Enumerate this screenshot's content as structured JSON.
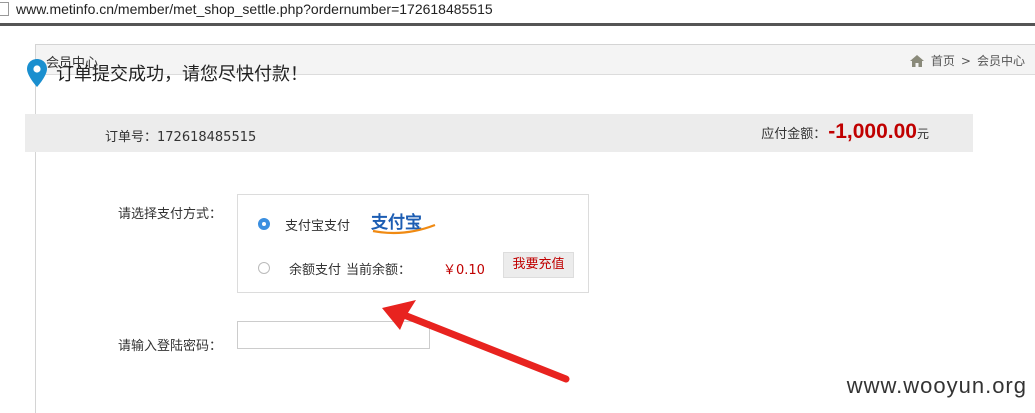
{
  "browser": {
    "url": "www.metinfo.cn/member/met_shop_settle.php?ordernumber=172618485515"
  },
  "panel": {
    "title": "会员中心",
    "breadcrumb": {
      "home": "首页",
      "separator": ">",
      "current": "会员中心"
    }
  },
  "message": {
    "success": "订单提交成功，请您尽快付款！"
  },
  "order": {
    "number_label": "订单号：",
    "number": "172618485515",
    "amount_label": "应付金额：",
    "amount": "-1,000.00",
    "amount_unit": "元"
  },
  "payment": {
    "label": "请选择支付方式：",
    "options": [
      {
        "label": "支付宝支付",
        "selected": true,
        "logo_text": "支付宝"
      },
      {
        "label": "余额支付",
        "selected": false
      }
    ],
    "balance_label": "当前余额：",
    "balance": "￥0.10",
    "recharge_button": "我要充值"
  },
  "password": {
    "label": "请输入登陆密码：",
    "value": ""
  },
  "watermark": "www.wooyun.org",
  "colors": {
    "accent_red": "#c00000",
    "radio_blue": "#3b8fe0",
    "order_bar_bg": "#ececec",
    "pin_blue": "#1a8fcf",
    "arrow_red": "#e8231f"
  }
}
